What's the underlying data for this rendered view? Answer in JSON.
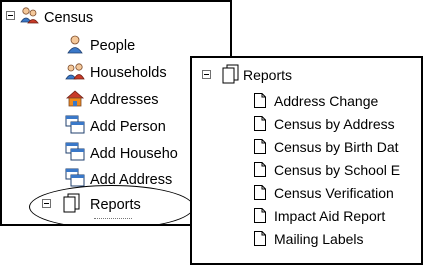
{
  "tree_back": {
    "root": "Census",
    "items": [
      {
        "label": "People",
        "icon": "person-icon"
      },
      {
        "label": "Households",
        "icon": "household-icon"
      },
      {
        "label": "Addresses",
        "icon": "house-icon"
      },
      {
        "label": "Add Person",
        "icon": "add-window-icon"
      },
      {
        "label": "Add Househo",
        "icon": "add-window-icon"
      },
      {
        "label": "Add Address",
        "icon": "add-window-icon"
      },
      {
        "label": "Reports",
        "icon": "report-folder-icon"
      }
    ]
  },
  "tree_front": {
    "root": "Reports",
    "items": [
      "Address Change",
      "Census by Address",
      "Census by Birth Dat",
      "Census by School E",
      "Census Verification",
      "Impact Aid Report",
      "Mailing Labels"
    ]
  },
  "colors": {
    "accent_orange": "#f08a1c",
    "accent_blue": "#3a78c8",
    "accent_red": "#c83a28"
  }
}
